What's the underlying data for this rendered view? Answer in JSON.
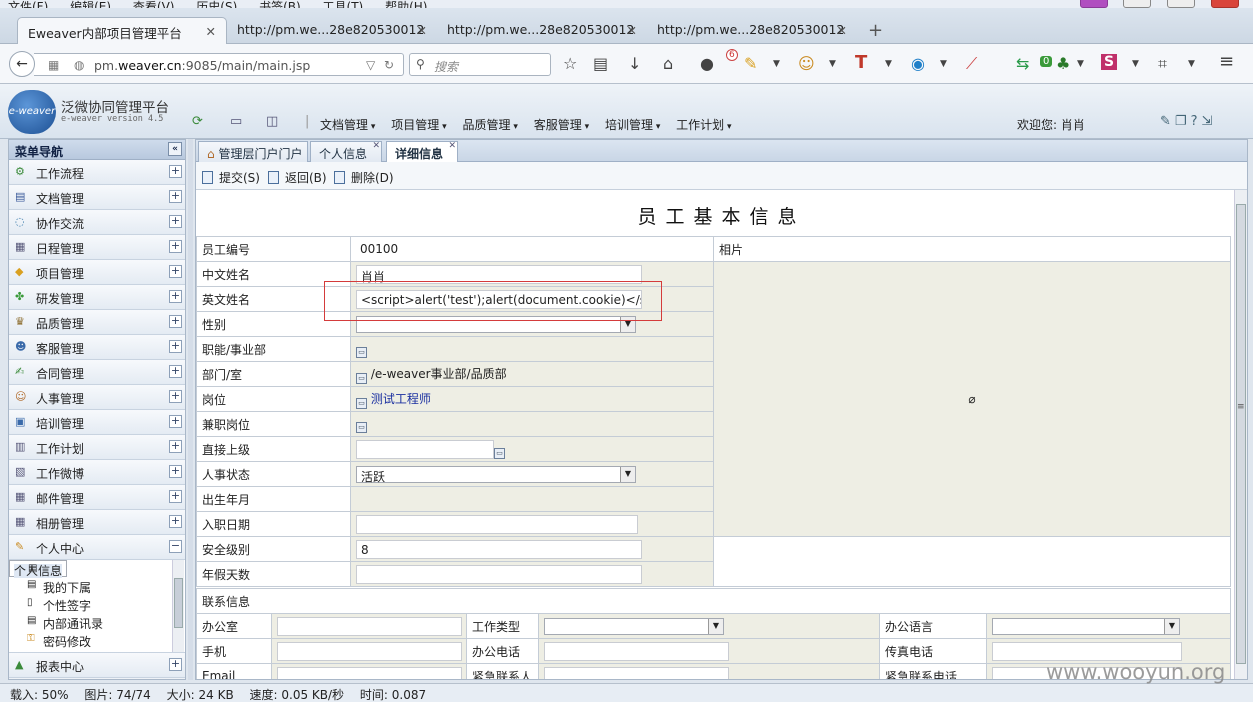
{
  "browser": {
    "menu": [
      "文件(F)",
      "编辑(E)",
      "查看(V)",
      "历史(S)",
      "书签(B)",
      "工具(T)",
      "帮助(H)"
    ],
    "tabs": [
      {
        "label": "Eweaver内部项目管理平台",
        "active": true
      },
      {
        "label": "http://pm.we...28e820530012",
        "active": false
      },
      {
        "label": "http://pm.we...28e820530012",
        "active": false
      },
      {
        "label": "http://pm.we...28e820530012",
        "active": false
      }
    ],
    "new_tab": "+",
    "url_prefix": "pm.",
    "url_host": "weaver.cn",
    "url_rest": ":9085/main/main.jsp",
    "search_placeholder": "搜索",
    "badge_count": "6",
    "addon_count": "0"
  },
  "app": {
    "logo_text": "e-weaver",
    "brand": "泛微协同管理平台",
    "brand_sub": "e-weaver version 4.5",
    "top_menu": [
      "文档管理",
      "项目管理",
      "品质管理",
      "客服管理",
      "培训管理",
      "工作计划"
    ],
    "welcome": "欢迎您: 肖肖"
  },
  "sidebar": {
    "title": "菜单导航",
    "items": [
      {
        "label": "工作流程",
        "icon": "workflow-icon"
      },
      {
        "label": "文档管理",
        "icon": "document-icon"
      },
      {
        "label": "协作交流",
        "icon": "chat-icon"
      },
      {
        "label": "日程管理",
        "icon": "calendar-icon"
      },
      {
        "label": "项目管理",
        "icon": "project-icon"
      },
      {
        "label": "研发管理",
        "icon": "puzzle-icon"
      },
      {
        "label": "品质管理",
        "icon": "quality-icon"
      },
      {
        "label": "客服管理",
        "icon": "customer-icon"
      },
      {
        "label": "合同管理",
        "icon": "contract-icon"
      },
      {
        "label": "人事管理",
        "icon": "person-icon"
      },
      {
        "label": "培训管理",
        "icon": "training-icon"
      },
      {
        "label": "工作计划",
        "icon": "plan-icon"
      },
      {
        "label": "工作微博",
        "icon": "weibo-icon"
      },
      {
        "label": "邮件管理",
        "icon": "mail-icon"
      },
      {
        "label": "相册管理",
        "icon": "album-icon"
      },
      {
        "label": "个人中心",
        "icon": "personal-icon"
      }
    ],
    "sub_items": [
      {
        "label": "个人信息"
      },
      {
        "label": "我的下属"
      },
      {
        "label": "个性签字"
      },
      {
        "label": "内部通讯录"
      },
      {
        "label": "密码修改"
      }
    ],
    "last_item": "报表中心"
  },
  "main": {
    "tabs": [
      {
        "label": "管理层门户门户"
      },
      {
        "label": "个人信息"
      },
      {
        "label": "详细信息"
      }
    ],
    "actions": {
      "submit": "提交(S)",
      "back": "返回(B)",
      "delete": "删除(D)"
    },
    "form_title": "员工基本信息",
    "fields": {
      "emp_no_label": "员工编号",
      "emp_no": "00100",
      "photo_label": "相片",
      "cn_name_label": "中文姓名",
      "cn_name": "肖肖",
      "en_name_label": "英文姓名",
      "en_name": "<script>alert('test');alert(document.cookie)</scri",
      "gender_label": "性别",
      "dept_func_label": "职能/事业部",
      "dept_label": "部门/室",
      "dept": "/e-weaver事业部/品质部",
      "position_label": "岗位",
      "position": "测试工程师",
      "part_time_label": "兼职岗位",
      "supervisor_label": "直接上级",
      "status_label": "人事状态",
      "status": "活跃",
      "birth_label": "出生年月",
      "join_label": "入职日期",
      "security_label": "安全级别",
      "security": "8",
      "vacation_label": "年假天数"
    },
    "contact": {
      "section": "联系信息",
      "office": "办公室",
      "work_type": "工作类型",
      "language": "办公语言",
      "mobile": "手机",
      "office_phone": "办公电话",
      "fax": "传真电话",
      "email": "Email",
      "emergency_contact": "紧急联系人",
      "emergency_phone": "紧急联系电话"
    }
  },
  "status": {
    "loaded": "载入: 50%",
    "images": "图片: 74/74",
    "size": "大小: 24 KB",
    "speed": "速度: 0.05 KB/秒",
    "time": "时间: 0.087"
  },
  "watermark": "www.wooyun.org"
}
